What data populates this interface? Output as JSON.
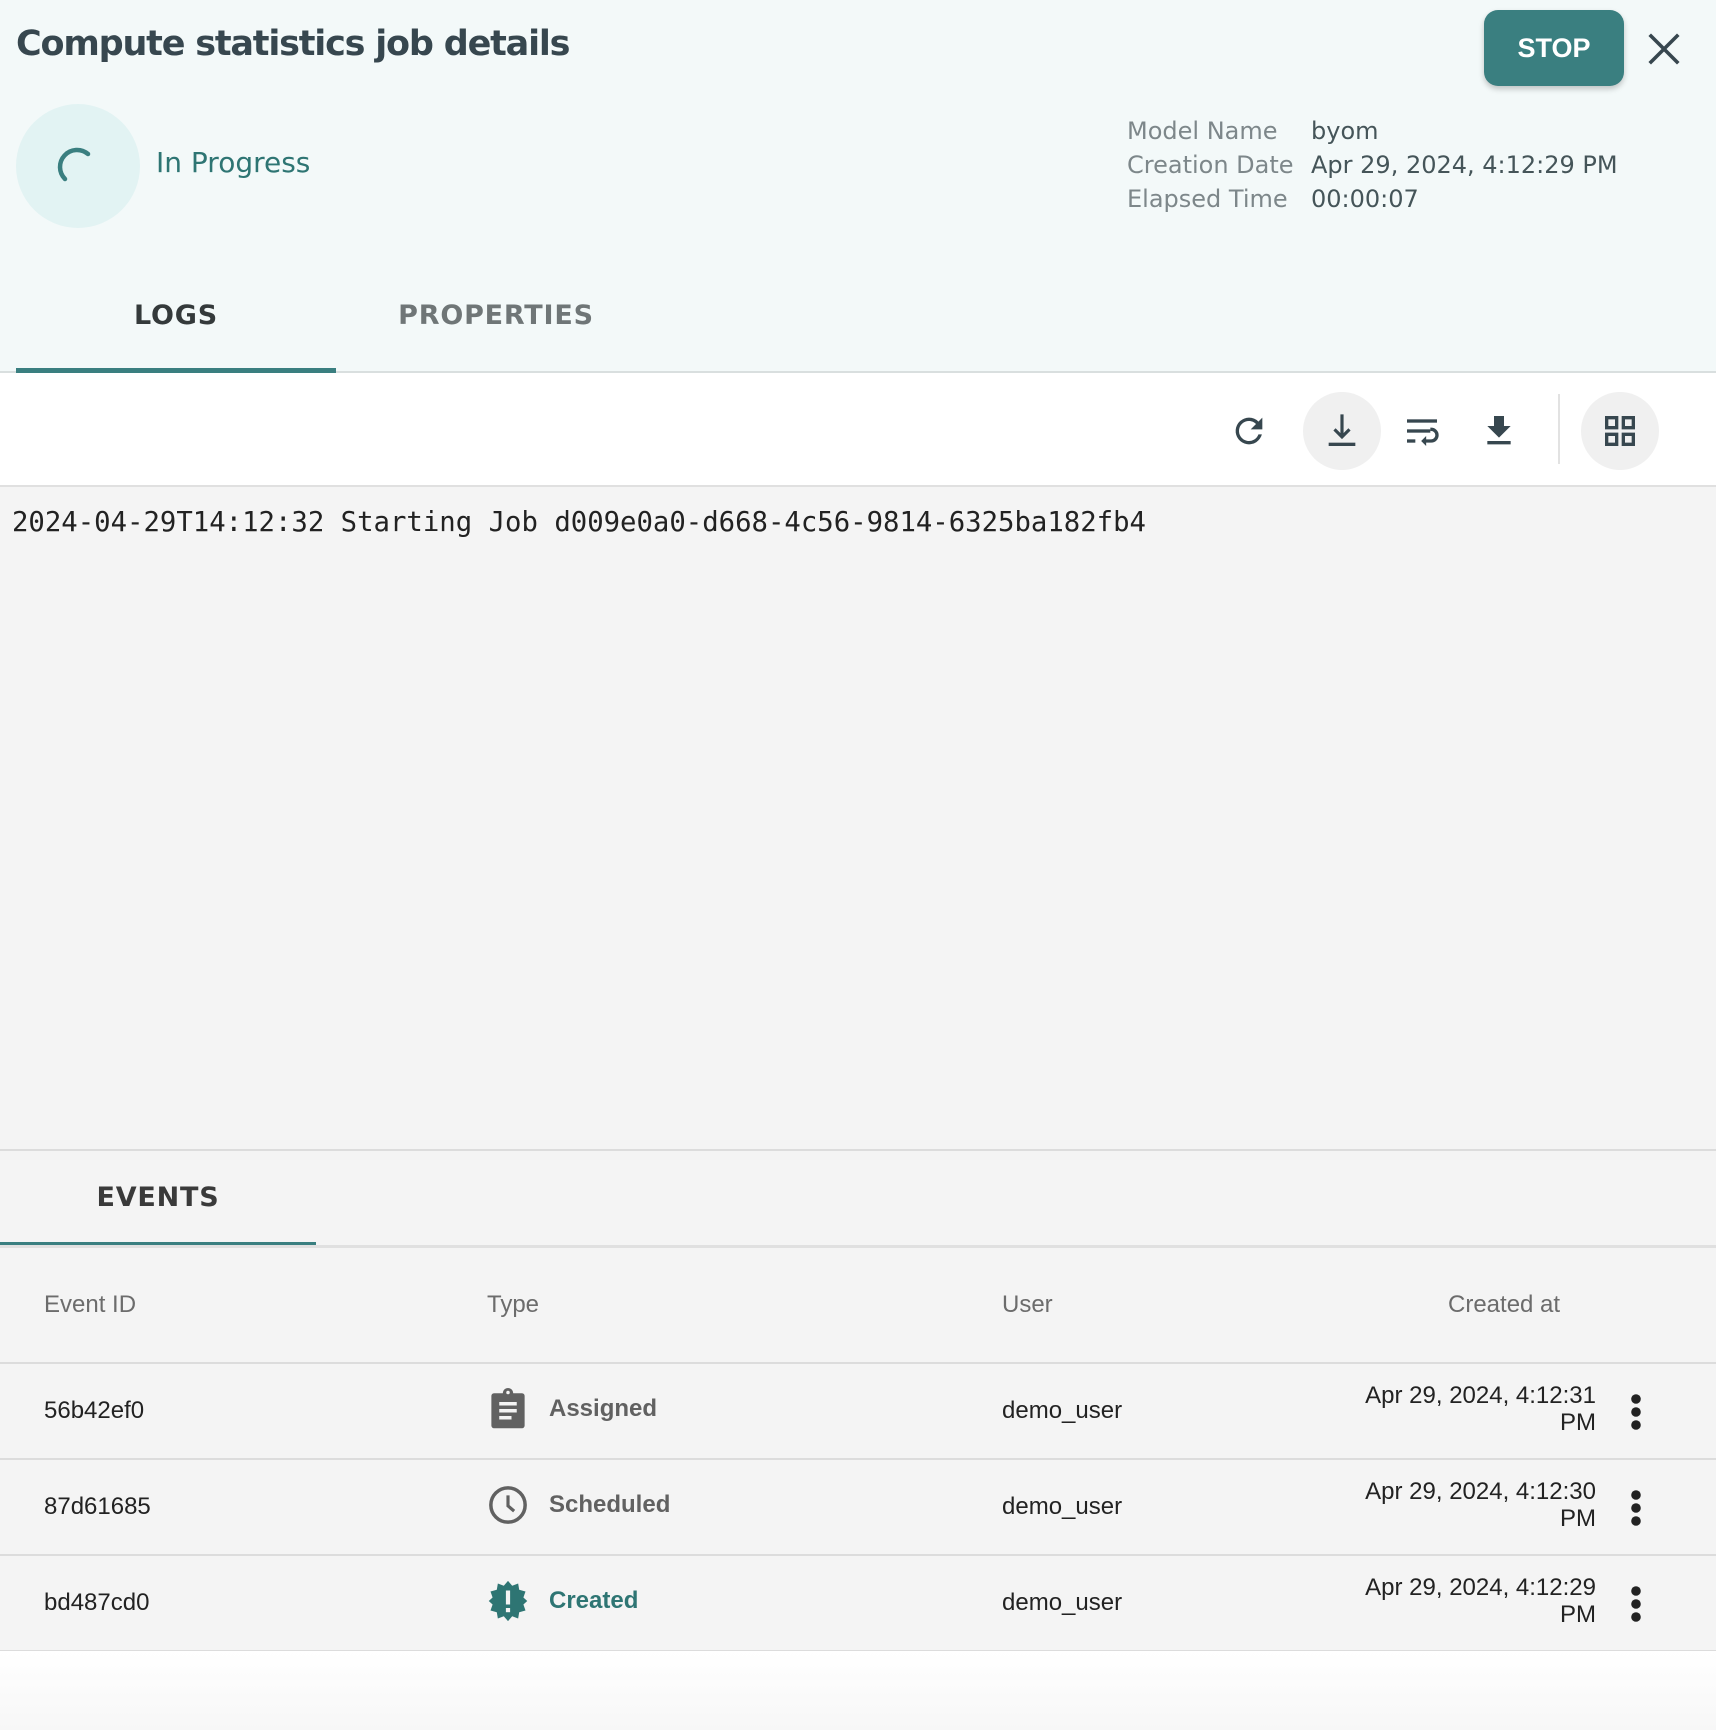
{
  "header": {
    "title": "Compute statistics job details",
    "stop_label": "STOP",
    "status": "In Progress",
    "meta": [
      {
        "label": "Model Name",
        "value": "byom"
      },
      {
        "label": "Creation Date",
        "value": "Apr 29, 2024, 4:12:29 PM"
      },
      {
        "label": "Elapsed Time",
        "value": "00:00:07"
      }
    ],
    "tabs": [
      {
        "label": "LOGS",
        "active": true
      },
      {
        "label": "PROPERTIES",
        "active": false
      }
    ]
  },
  "toolbar": {
    "icons": [
      "refresh-icon",
      "scroll-to-bottom-icon",
      "wrap-text-icon",
      "download-icon",
      "grid-view-icon"
    ]
  },
  "logs": {
    "lines": [
      "2024-04-29T14:12:32 Starting Job d009e0a0-d668-4c56-9814-6325ba182fb4"
    ]
  },
  "events": {
    "tab_label": "EVENTS",
    "columns": [
      "Event ID",
      "Type",
      "User",
      "Created at"
    ],
    "rows": [
      {
        "id": "56b42ef0",
        "type": "Assigned",
        "type_icon": "clipboard-icon",
        "user": "demo_user",
        "created_at_line1": "Apr 29, 2024, 4:12:31",
        "created_at_line2": "PM"
      },
      {
        "id": "87d61685",
        "type": "Scheduled",
        "type_icon": "clock-icon",
        "user": "demo_user",
        "created_at_line1": "Apr 29, 2024, 4:12:30",
        "created_at_line2": "PM"
      },
      {
        "id": "bd487cd0",
        "type": "Created",
        "type_icon": "new-badge-icon",
        "user": "demo_user",
        "created_at_line1": "Apr 29, 2024, 4:12:29",
        "created_at_line2": "PM"
      }
    ]
  },
  "colors": {
    "accent": "#3a7f80",
    "status_text": "#2e7573",
    "header_bg": "#f3f9f9",
    "log_bg": "#f4f4f4"
  }
}
